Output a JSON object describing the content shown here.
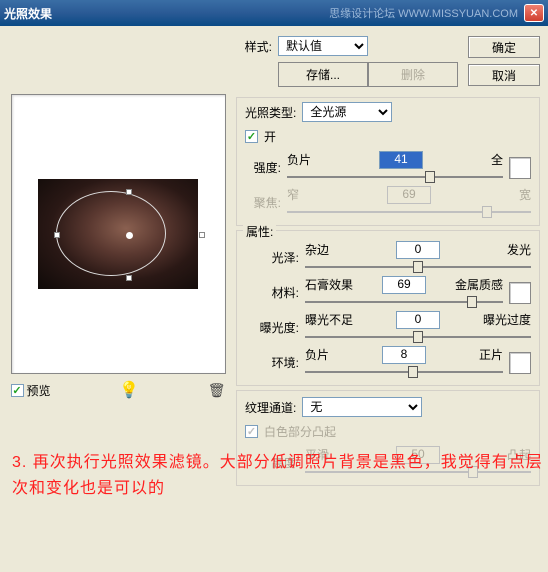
{
  "window": {
    "title": "光照效果",
    "watermark": "思缘设计论坛  WWW.MISSYUAN.COM"
  },
  "buttons": {
    "ok": "确定",
    "cancel": "取消",
    "save": "存储...",
    "delete": "删除"
  },
  "style": {
    "label": "样式:",
    "value": "默认值"
  },
  "preview": {
    "label": "预览"
  },
  "light": {
    "legend": "光照类型:",
    "value": "全光源",
    "on_label": "开",
    "intensity": {
      "label": "强度:",
      "left": "负片",
      "right": "全",
      "value": "41"
    },
    "focus": {
      "label": "聚焦:",
      "left": "窄",
      "right": "宽",
      "value": "69"
    }
  },
  "props": {
    "legend": "属性:",
    "gloss": {
      "label": "光泽:",
      "left": "杂边",
      "right": "发光",
      "value": "0"
    },
    "material": {
      "label": "材料:",
      "left": "石膏效果",
      "right": "金属质感",
      "value": "69"
    },
    "exposure": {
      "label": "曝光度:",
      "left": "曝光不足",
      "right": "曝光过度",
      "value": "0"
    },
    "ambience": {
      "label": "环境:",
      "left": "负片",
      "right": "正片",
      "value": "8"
    }
  },
  "texture": {
    "label": "纹理通道:",
    "value": "无",
    "white_high": "白色部分凸起",
    "height": {
      "label": "高度:",
      "left": "平滑",
      "right": "凸起",
      "value": "50"
    }
  },
  "annotation": "3. 再次执行光照效果滤镜。大部分低调照片背景是黑色，我觉得有点层次和变化也是可以的"
}
